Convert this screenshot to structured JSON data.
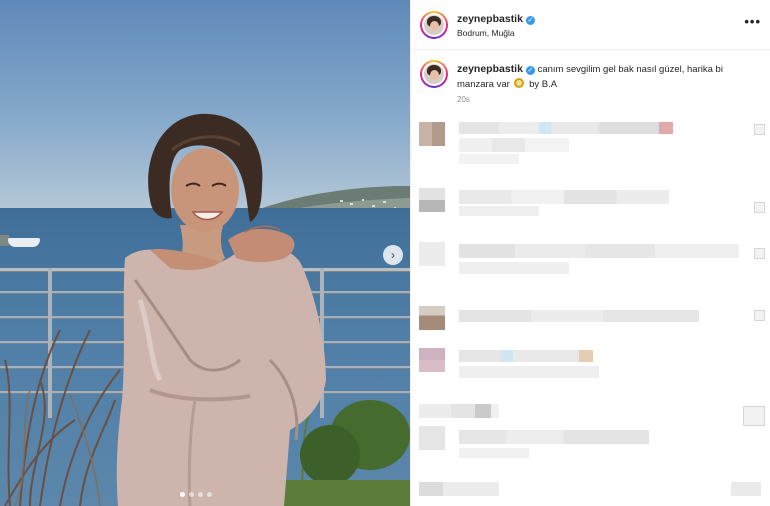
{
  "post": {
    "username": "zeynepbastik",
    "location": "Bodrum, Muğla",
    "caption_pre": "canım sevgilim gel bak nasıl güzel, harika bi manzara var",
    "caption_post": "by B.A",
    "time": "20s",
    "verified_icon": "verified-badge-icon",
    "more_label": "•••"
  },
  "carousel": {
    "next_label": "›",
    "slides": 4,
    "active_slide": 1
  },
  "colors": {
    "verified": "#3897f0",
    "text": "#262626",
    "muted": "#8e8e8e"
  }
}
